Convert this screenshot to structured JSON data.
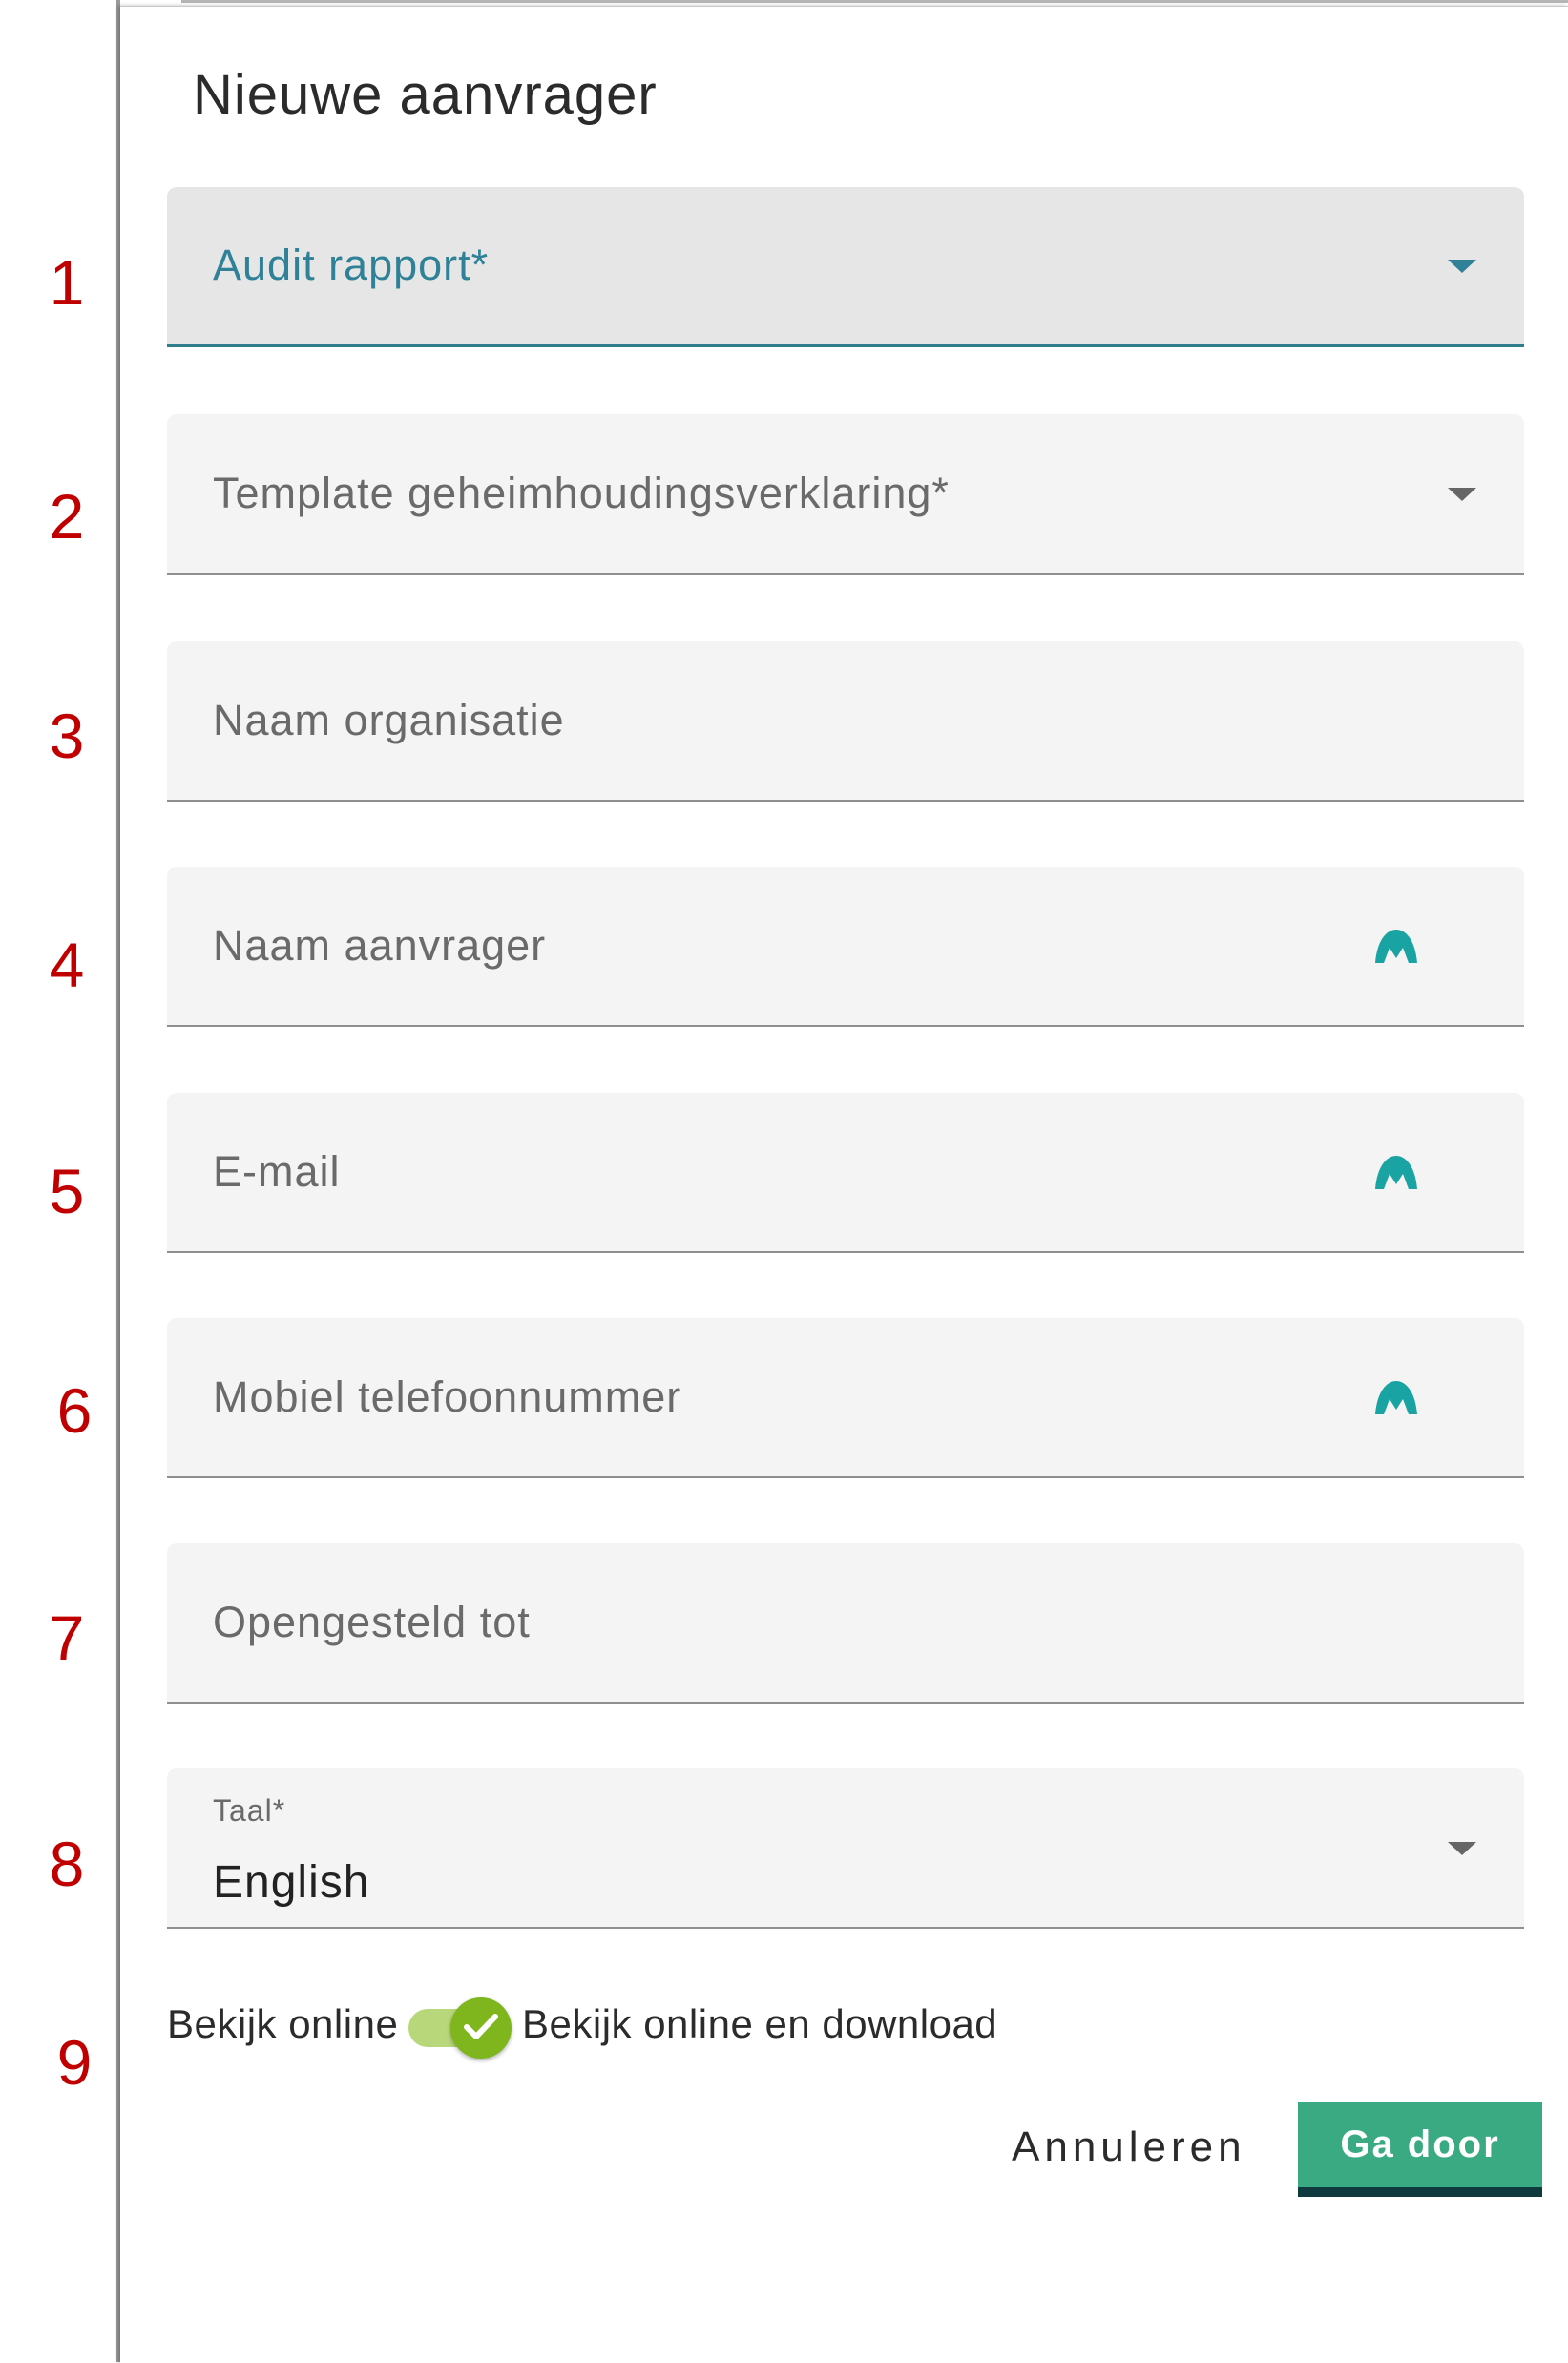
{
  "dialog": {
    "title": "Nieuwe aanvrager"
  },
  "markers": [
    "1",
    "2",
    "3",
    "4",
    "5",
    "6",
    "7",
    "8",
    "9"
  ],
  "fields": {
    "audit_rapport": {
      "label": "Audit rapport*"
    },
    "template": {
      "label": "Template geheimhoudingsverklaring*"
    },
    "organisatie": {
      "label": "Naam organisatie"
    },
    "aanvrager": {
      "label": "Naam aanvrager"
    },
    "email": {
      "label": "E-mail"
    },
    "mobiel": {
      "label": "Mobiel telefoonnummer"
    },
    "opengesteld": {
      "label": "Opengesteld tot"
    },
    "taal": {
      "label": "Taal*",
      "value": "English"
    }
  },
  "toggle": {
    "off_label": "Bekijk online",
    "on_label": "Bekijk online en download",
    "checked": true
  },
  "actions": {
    "cancel_label": "Annuleren",
    "continue_label": "Ga door"
  },
  "colors": {
    "accent": "#2e8197",
    "primary_button": "#3aaa82",
    "toggle_on": "#7fb51d",
    "marker": "#c00000",
    "autofill_icon": "#1aa3a3"
  },
  "icons": {
    "dropdown": "caret-down-icon",
    "autofill": "autofill-peak-icon",
    "toggle": "check-icon"
  }
}
